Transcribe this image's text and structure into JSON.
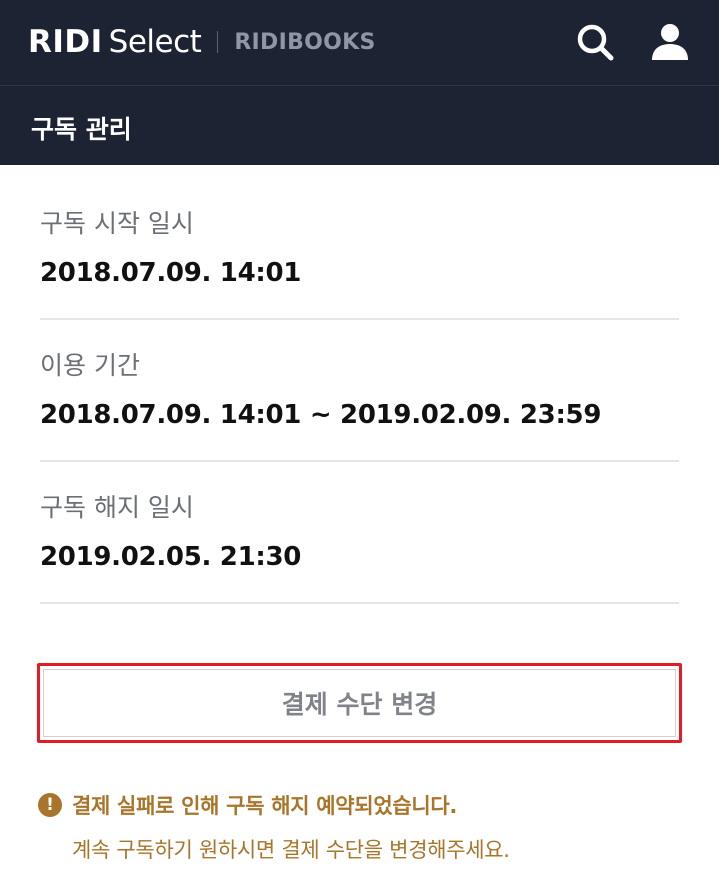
{
  "header": {
    "brand_primary": "RIDI",
    "brand_secondary": "Select",
    "brand_partner": "RIDIBOOKS",
    "search_icon": "search-icon",
    "user_icon": "user-icon"
  },
  "subheader": {
    "title": "구독 관리"
  },
  "subscription": {
    "start": {
      "label": "구독 시작 일시",
      "value": "2018.07.09. 14:01"
    },
    "period": {
      "label": "이용 기간",
      "value": "2018.07.09. 14:01 ~ 2019.02.09. 23:59"
    },
    "cancel": {
      "label": "구독 해지 일시",
      "value": "2019.02.05. 21:30"
    }
  },
  "actions": {
    "change_payment_label": "결제 수단 변경"
  },
  "notice": {
    "icon": "!",
    "title": "결제 실패로 인해 구독 해지 예약되었습니다.",
    "description": "계속 구독하기 원하시면 결제 수단을 변경해주세요."
  },
  "colors": {
    "header_bg": "#1c2434",
    "highlight_border": "#e31c24",
    "notice": "#a9752a"
  }
}
